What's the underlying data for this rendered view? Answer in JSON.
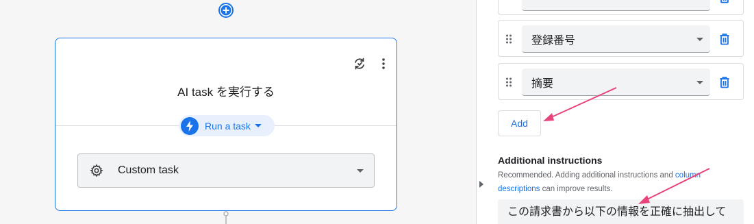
{
  "canvas": {
    "add_step_icon": "plus-circle-icon",
    "card": {
      "title": "AI task を実行する",
      "refresh_icon": "refresh-icon",
      "more_icon": "more-vert-icon",
      "run_button": {
        "label": "Run a task",
        "icon": "bolt-icon"
      },
      "task_select": {
        "value": "Custom task",
        "icon": "gear-icon"
      }
    }
  },
  "panel": {
    "columns": [
      {
        "value": "登録番号"
      },
      {
        "value": "摘要"
      }
    ],
    "add_button_label": "Add",
    "additional_instructions": {
      "heading": "Additional instructions",
      "help_prefix": "Recommended. Adding additional instructions and ",
      "help_link": "column descriptions",
      "help_suffix": " can improve results.",
      "value": "この請求書から以下の情報を正確に抽出して"
    }
  },
  "colors": {
    "accent": "#1a73e8",
    "annotation_arrow": "#e8437a",
    "canvas_bg": "#f6f6f6"
  }
}
